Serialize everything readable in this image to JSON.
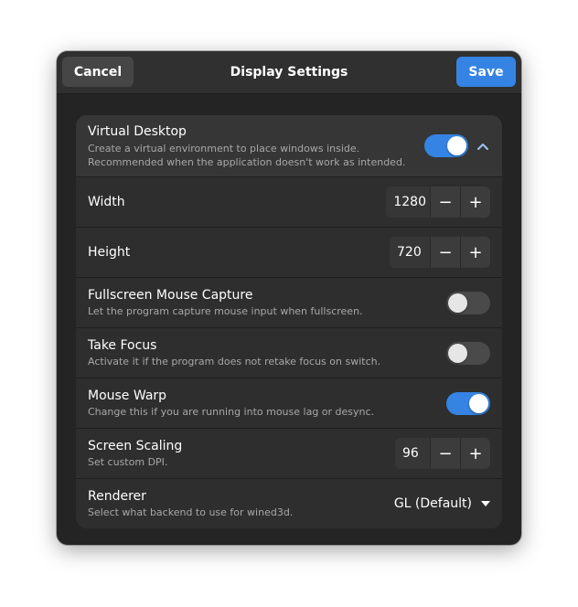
{
  "window": {
    "title": "Display Settings",
    "cancel_label": "Cancel",
    "save_label": "Save"
  },
  "colors": {
    "accent": "#3584e4",
    "window_bg": "#242424",
    "row_bg": "#303030"
  },
  "virtual_desktop": {
    "title": "Virtual Desktop",
    "subtitle_line1": "Create a virtual environment to place windows inside.",
    "subtitle_line2": "Recommended when the application doesn't work as intended.",
    "enabled": true,
    "expanded": true,
    "expander_icon": "chevron-up-icon"
  },
  "width": {
    "title": "Width",
    "value": "1280",
    "minus": "−",
    "plus": "+"
  },
  "height": {
    "title": "Height",
    "value": "720",
    "minus": "−",
    "plus": "+"
  },
  "fullscreen_mouse_capture": {
    "title": "Fullscreen Mouse Capture",
    "subtitle": "Let the program capture mouse input when fullscreen.",
    "enabled": false
  },
  "take_focus": {
    "title": "Take Focus",
    "subtitle": "Activate it if the program does not retake focus on switch.",
    "enabled": false
  },
  "mouse_warp": {
    "title": "Mouse Warp",
    "subtitle": "Change this if you are running into mouse lag or desync.",
    "enabled": true
  },
  "screen_scaling": {
    "title": "Screen Scaling",
    "subtitle": "Set custom DPI.",
    "value": "96",
    "minus": "−",
    "plus": "+"
  },
  "renderer": {
    "title": "Renderer",
    "subtitle": "Select what backend to use for wined3d.",
    "selected": "GL (Default)",
    "dropdown_icon": "pan-down-icon"
  }
}
